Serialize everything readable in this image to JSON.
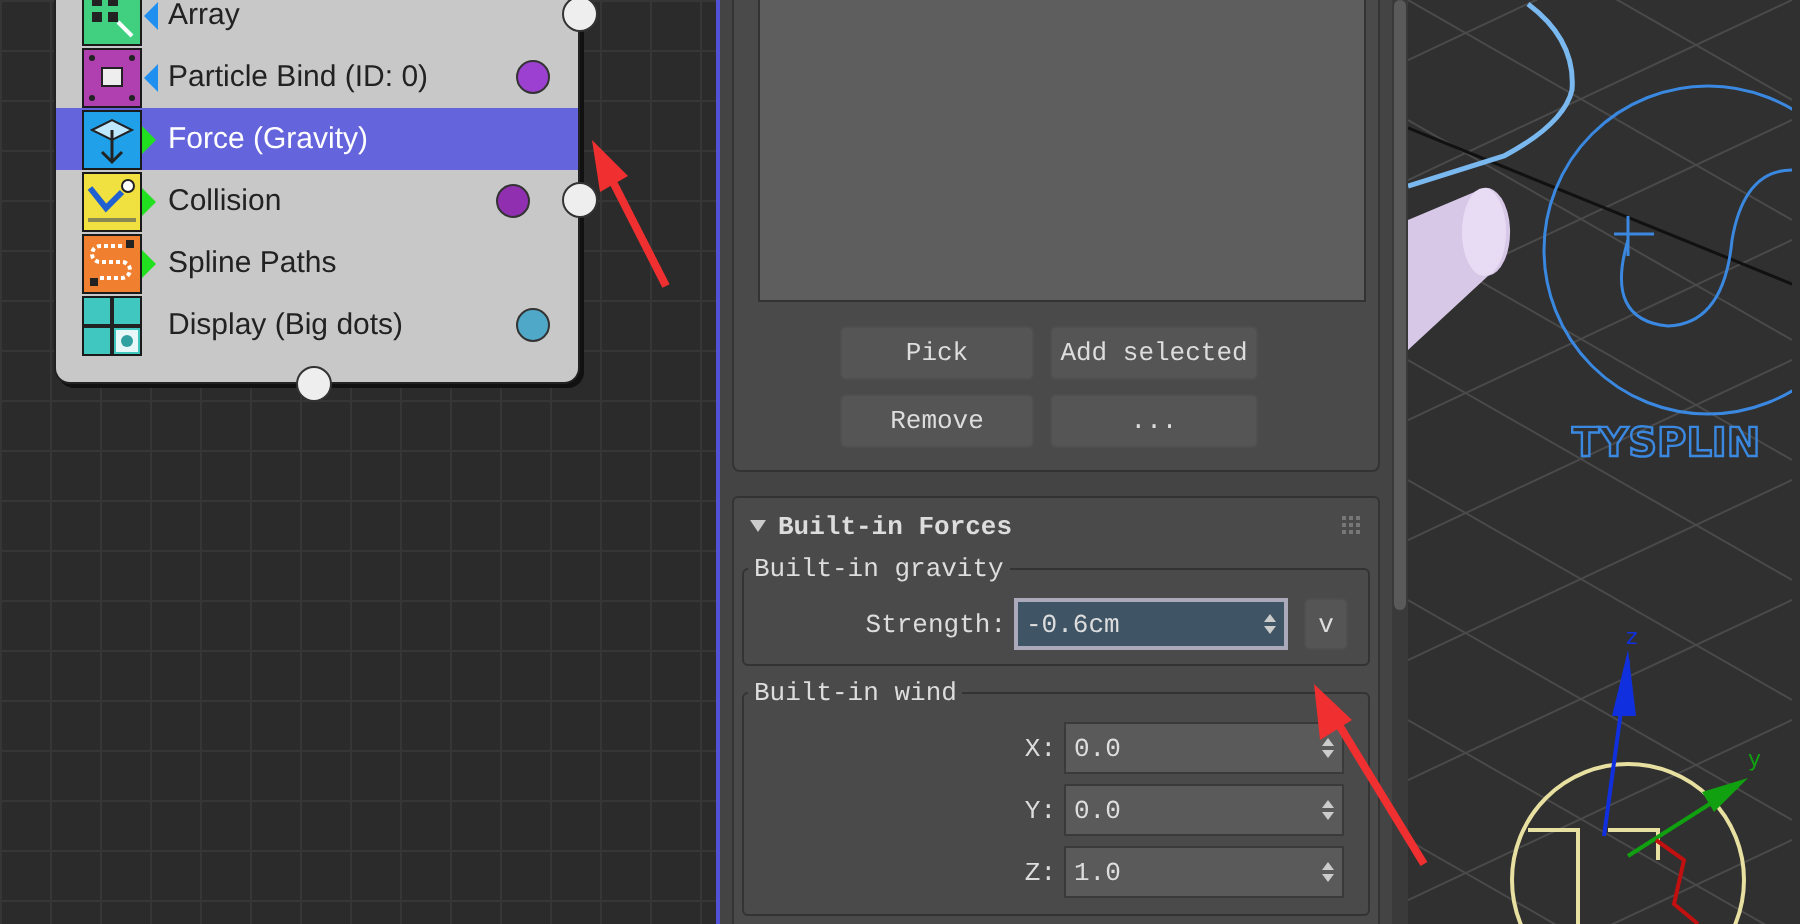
{
  "node_editor": {
    "rows": [
      {
        "label": "Array",
        "kind": "array",
        "input_arrow": true,
        "output_arrow": false,
        "selected": false,
        "socket": true
      },
      {
        "label": "Particle Bind (ID: 0)",
        "kind": "bind",
        "input_arrow": true,
        "output_arrow": false,
        "selected": false,
        "color": "#9b40d0",
        "socket": false
      },
      {
        "label": "Force (Gravity)",
        "kind": "force",
        "input_arrow": false,
        "output_arrow": true,
        "selected": true,
        "socket": false
      },
      {
        "label": "Collision",
        "kind": "collision",
        "input_arrow": false,
        "output_arrow": true,
        "selected": false,
        "color": "#9030b0",
        "socket": true
      },
      {
        "label": "Spline Paths",
        "kind": "spline",
        "input_arrow": false,
        "output_arrow": true,
        "selected": false,
        "socket": false
      },
      {
        "label": "Display (Big dots)",
        "kind": "display",
        "input_arrow": false,
        "output_arrow": false,
        "selected": false,
        "color": "#50a8c8",
        "socket": false
      }
    ]
  },
  "panel": {
    "buttons": [
      "Pick",
      "Add selected",
      "Remove",
      "..."
    ],
    "rollout": {
      "title": "Built-in Forces",
      "expanded": true,
      "groups": [
        {
          "title": "Built-in gravity",
          "fields": [
            {
              "label": "Strength:",
              "value": "-0.6cm",
              "focused": true,
              "extra_button": "v"
            }
          ]
        },
        {
          "title": "Built-in wind",
          "fields": [
            {
              "label": "X:",
              "value": "0.0",
              "focused": false
            },
            {
              "label": "Y:",
              "value": "0.0",
              "focused": false
            },
            {
              "label": "Z:",
              "value": "1.0",
              "focused": false
            }
          ]
        }
      ]
    }
  },
  "viewport": {
    "logo_text": "TYSPLIN",
    "axes": [
      "z",
      "y"
    ]
  },
  "annotations": [
    {
      "kind": "arrow"
    },
    {
      "kind": "arrow"
    }
  ]
}
